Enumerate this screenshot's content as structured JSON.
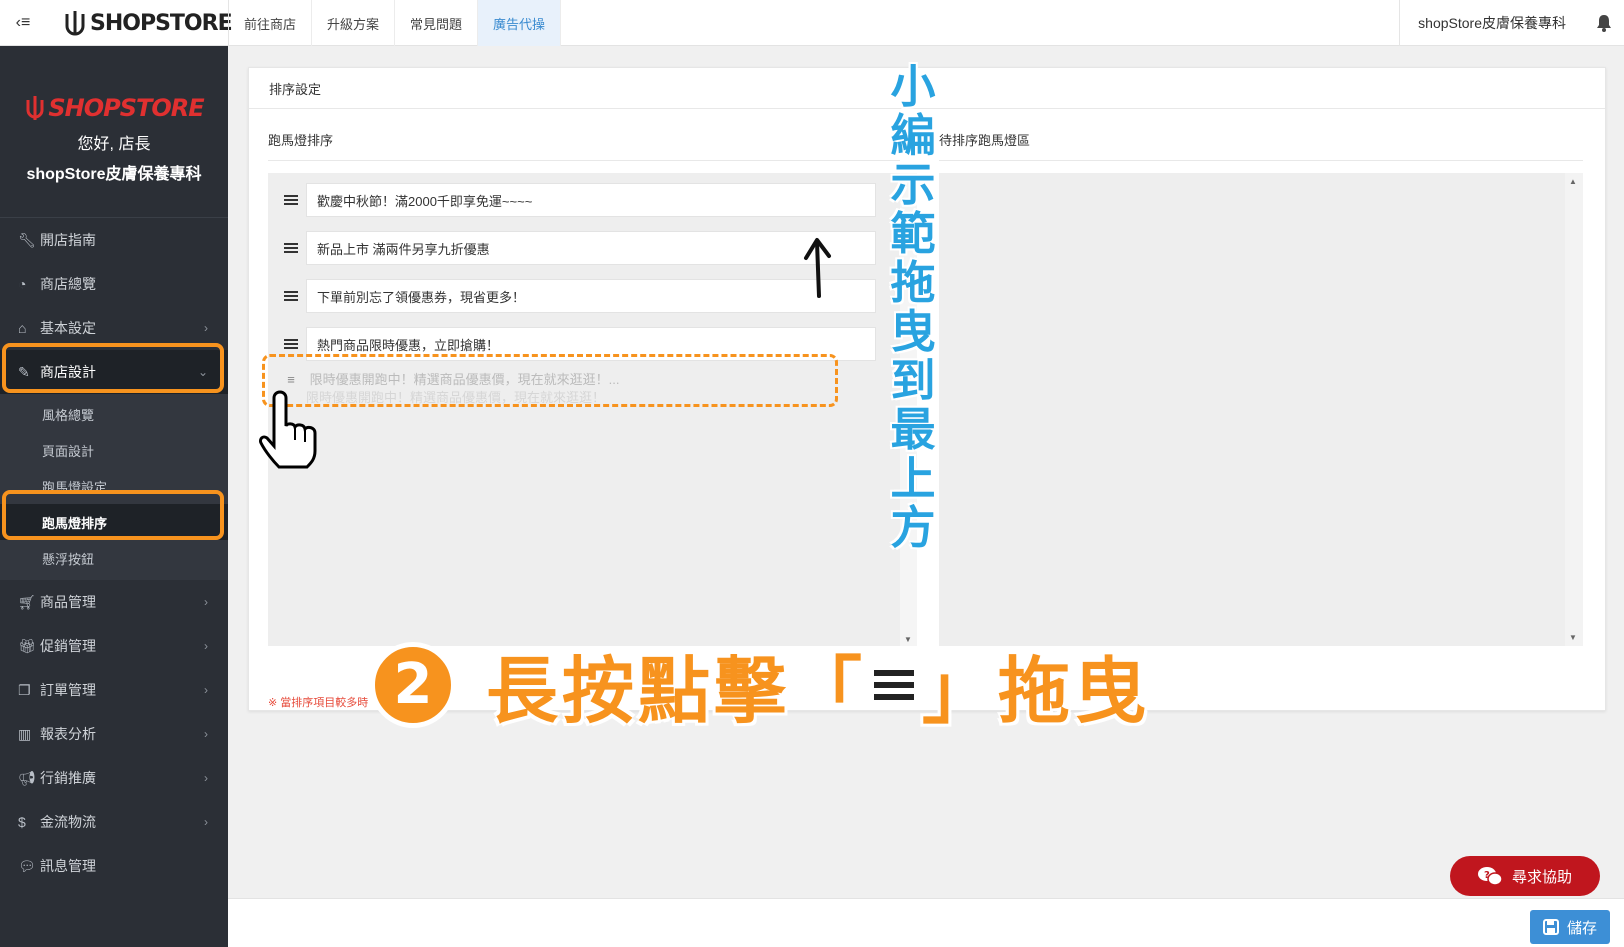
{
  "topbar": {
    "menu_icon": "‹≡",
    "logo_text": "SHOPSTORE",
    "nav": [
      "前往商店",
      "升級方案",
      "常見問題",
      "廣告代操"
    ],
    "active_nav": "廣告代操",
    "store_name": "shopStore皮膚保養專科"
  },
  "sidebar": {
    "logo_text": "SHOPSTORE",
    "greeting": "您好, 店長",
    "store_name": "shopStore皮膚保養專科",
    "items": [
      {
        "label": "開店指南",
        "icon": "wrench-icon"
      },
      {
        "label": "商店總覽",
        "icon": "dashboard-icon"
      },
      {
        "label": "基本設定",
        "icon": "bank-icon"
      },
      {
        "label": "商店設計",
        "icon": "magic-wand-icon"
      },
      {
        "label": "商品管理",
        "icon": "cart-icon"
      },
      {
        "label": "促銷管理",
        "icon": "gift-icon"
      },
      {
        "label": "訂單管理",
        "icon": "copy-icon"
      },
      {
        "label": "報表分析",
        "icon": "bar-chart-icon"
      },
      {
        "label": "行銷推廣",
        "icon": "megaphone-icon"
      },
      {
        "label": "金流物流",
        "icon": "dollar-icon"
      },
      {
        "label": "訊息管理",
        "icon": "comments-icon"
      }
    ],
    "sub_items": [
      "風格總覽",
      "頁面設計",
      "跑馬燈設定",
      "跑馬燈排序",
      "懸浮按鈕"
    ],
    "active_sub": "跑馬燈排序"
  },
  "panel": {
    "title": "排序設定",
    "left_title": "跑馬燈排序",
    "right_title": "待排序跑馬燈區",
    "rows": [
      "歡慶中秋節！滿2000千即享免運~~~~",
      "新品上市 滿兩件另享九折優惠",
      "下單前別忘了領優惠券，現省更多！",
      "熱門商品限時優惠，立即搶購！"
    ],
    "dragging_text": "限時優惠開跑中！精選商品優惠價，現在就來逛逛！...",
    "dragging_shadow": "限時優惠開跑中！精選商品優惠價，現在就來逛逛！",
    "warning": "※ 當排序項目較多時"
  },
  "annotation": {
    "vertical_note": "小編示範拖曳到最上方",
    "step_number": "2",
    "step_text_a": "長按點擊「",
    "step_text_b": "」拖曳"
  },
  "buttons": {
    "help": "尋求協助",
    "save": "儲存"
  },
  "colors": {
    "sidebar_bg": "#2b2f36",
    "highlight": "#f7931e",
    "note_blue": "#29a3e0",
    "help_red": "#c0161e",
    "save_blue": "#3d8fd6"
  }
}
